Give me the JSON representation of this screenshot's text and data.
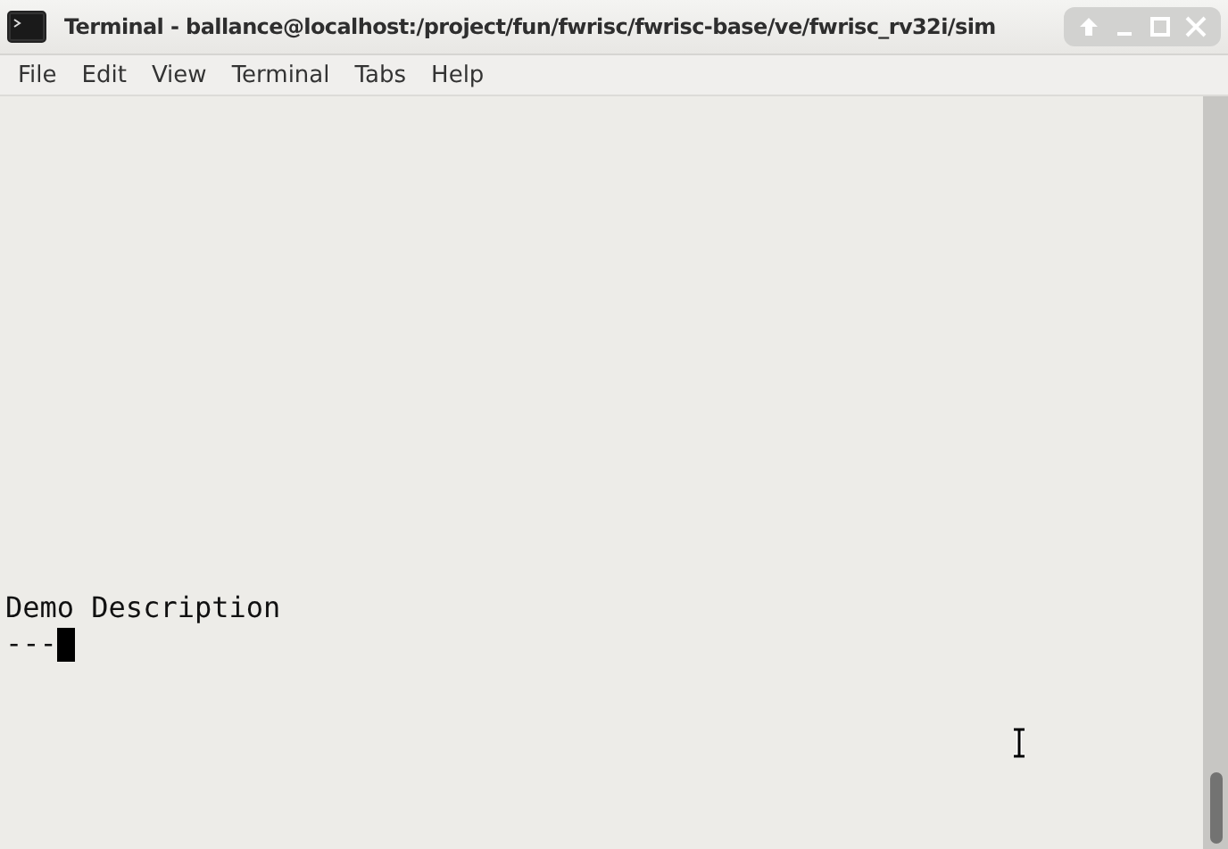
{
  "window": {
    "title": "Terminal - ballance@localhost:/project/fun/fwrisc/fwrisc-base/ve/fwrisc_rv32i/sim"
  },
  "menu": [
    "File",
    "Edit",
    "View",
    "Terminal",
    "Tabs",
    "Help"
  ],
  "terminal": {
    "lines": [
      "Demo Description",
      "---"
    ]
  }
}
